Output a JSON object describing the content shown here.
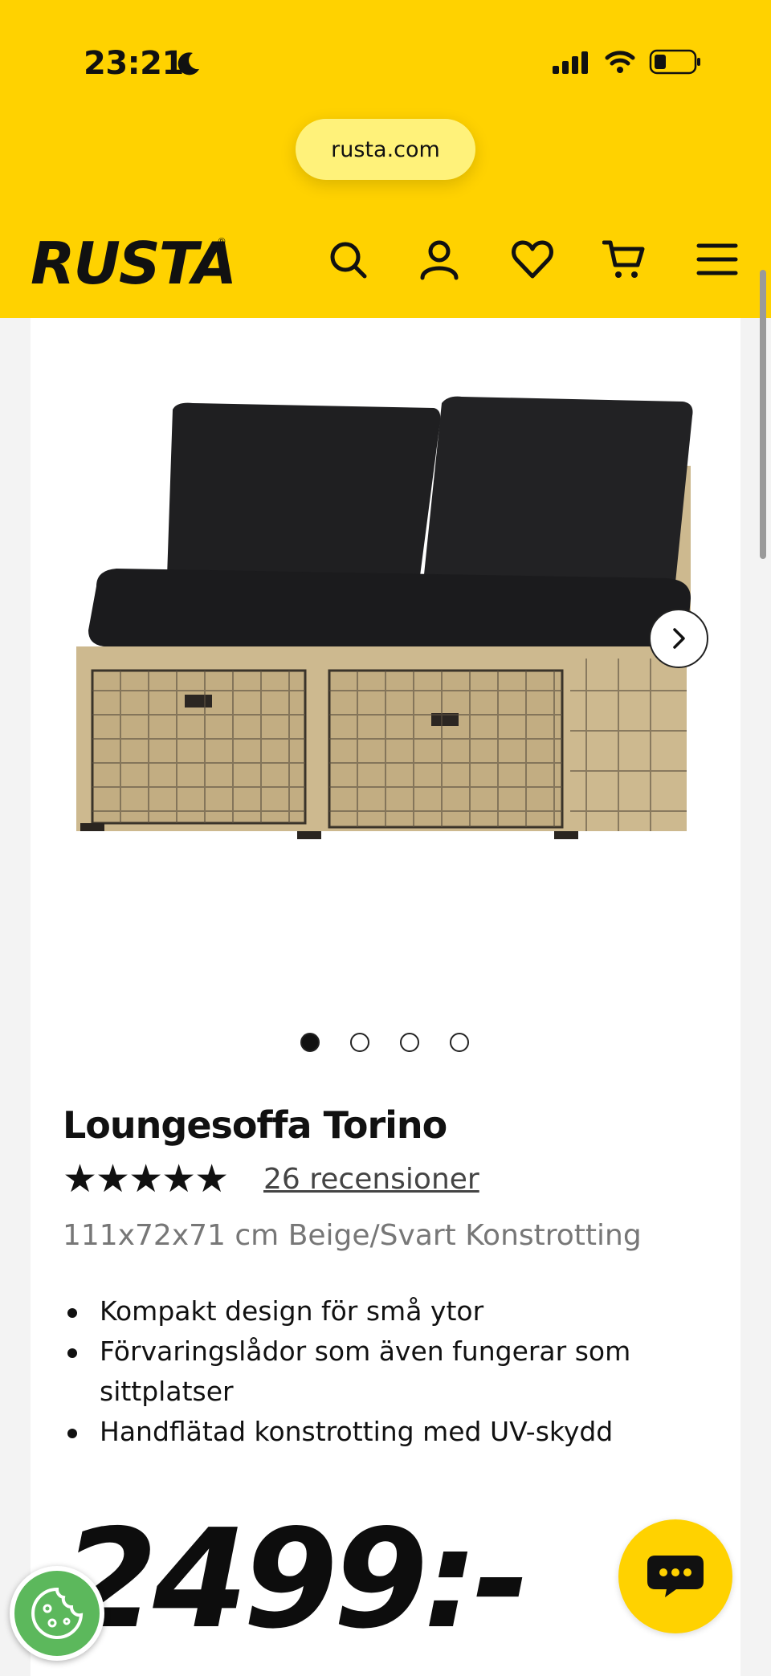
{
  "status_bar": {
    "time": "23:21"
  },
  "browser": {
    "url": "rusta.com"
  },
  "header": {
    "logo": "RUSTA",
    "logo_mark": "®",
    "icons": [
      "search-icon",
      "account-icon",
      "heart-icon",
      "cart-icon",
      "menu-icon"
    ]
  },
  "gallery": {
    "image_count": 4,
    "active_index": 0
  },
  "product": {
    "title": "Loungesoffa Torino",
    "rating": 5,
    "rating_stars": "★★★★★",
    "reviews_label": "26 recensioner",
    "subtitle": "111x72x71 cm Beige/Svart Konstrotting",
    "features": [
      "Kompakt design för små ytor",
      "Förvaringslådor som även fungerar som sittplatser",
      "Handflätad konstrotting med UV-skydd"
    ],
    "price": "2499:-"
  },
  "colors": {
    "brand_yellow": "#ffd200",
    "cookie_green": "#5cb85c"
  }
}
